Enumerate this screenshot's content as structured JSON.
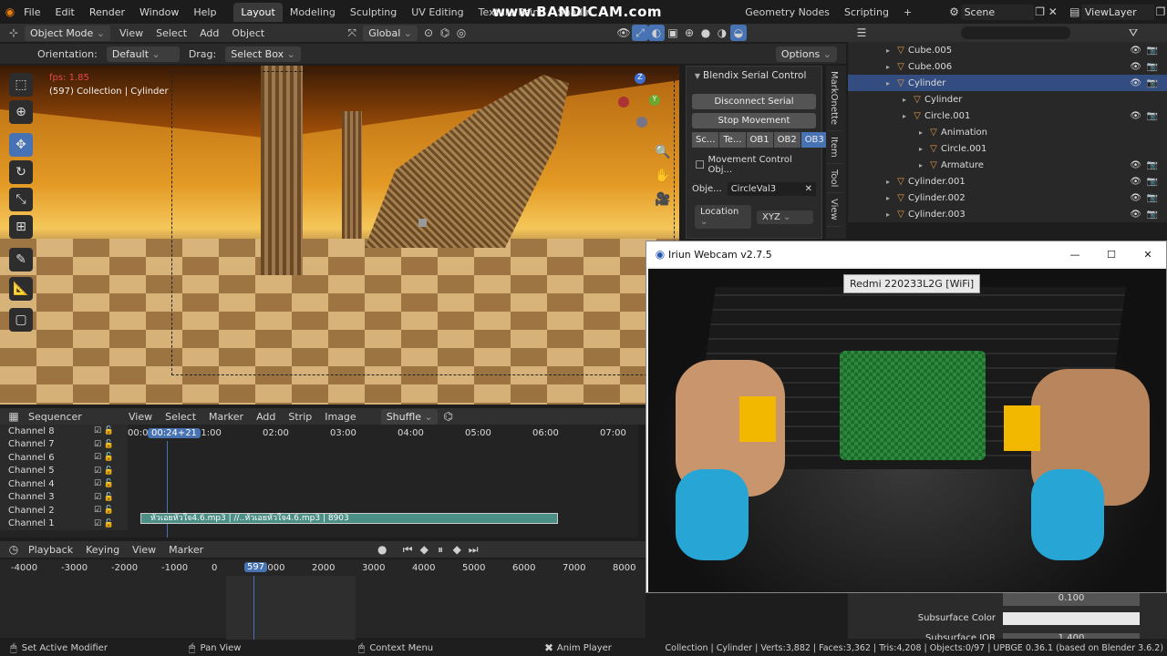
{
  "topbar": {
    "menus": [
      "File",
      "Edit",
      "Render",
      "Window",
      "Help"
    ],
    "workspaces": [
      "Layout",
      "Modeling",
      "Sculpting",
      "UV Editing",
      "Texture Paint",
      "Shadin"
    ],
    "workspaces2": [
      "Geometry Nodes",
      "Scripting"
    ],
    "add": "+",
    "watermark": "www.BANDICAM.com",
    "scene": "Scene",
    "viewlayer": "ViewLayer"
  },
  "vp_header": {
    "mode": "Object Mode",
    "menus": [
      "View",
      "Select",
      "Add",
      "Object"
    ],
    "transform": "Global"
  },
  "vp_tool": {
    "orientation_label": "Orientation:",
    "orientation": "Default",
    "drag_label": "Drag:",
    "drag": "Select Box",
    "options": "Options"
  },
  "vp_stats": {
    "fps": "fps: 1.85",
    "collection": "(597) Collection | Cylinder"
  },
  "gizmo": {
    "z": "Z",
    "y": "Y",
    "x": "X"
  },
  "npanel": {
    "title": "Blendix Serial Control",
    "btn1": "Disconnect Serial",
    "btn2": "Stop Movement",
    "tabs": [
      "Sc...",
      "Te...",
      "OB1",
      "OB2",
      "OB3"
    ],
    "section": "Movement Control Obj...",
    "obj_label": "Obje...",
    "obj_value": "CircleVal3",
    "loc": "Location",
    "xyz": "XYZ"
  },
  "sidetabs": [
    "MarkOnette",
    "Item",
    "Tool",
    "View"
  ],
  "outliner": {
    "rows": [
      {
        "name": "Cube.005",
        "indent": 1
      },
      {
        "name": "Cube.006",
        "indent": 1
      },
      {
        "name": "Cylinder",
        "indent": 1,
        "sel": true
      },
      {
        "name": "Cylinder",
        "indent": 2
      },
      {
        "name": "Circle.001",
        "indent": 2
      },
      {
        "name": "Animation",
        "indent": 3
      },
      {
        "name": "Circle.001",
        "indent": 3
      },
      {
        "name": "Armature",
        "indent": 3
      },
      {
        "name": "Cylinder.001",
        "indent": 1
      },
      {
        "name": "Cylinder.002",
        "indent": 1
      },
      {
        "name": "Cylinder.003",
        "indent": 1
      }
    ]
  },
  "seq": {
    "editor": "Sequencer",
    "menus": [
      "View",
      "Select",
      "Marker",
      "Add",
      "Strip",
      "Image"
    ],
    "shuffle": "Shuffle",
    "channels": [
      "Channel 8",
      "Channel 7",
      "Channel 6",
      "Channel 5",
      "Channel 4",
      "Channel 3",
      "Channel 2",
      "Channel 1"
    ],
    "current": "00:24+21",
    "times": [
      "00:0",
      "01:00",
      "02:00",
      "03:00",
      "04:00",
      "05:00",
      "06:00",
      "07:00"
    ],
    "strip": "หัวเอยหัวใจ4.6.mp3 | //..หัวเอยหัวใจ4.6.mp3 | 8903"
  },
  "timeline": {
    "menus": [
      "Playback",
      "Keying",
      "View",
      "Marker"
    ],
    "frame": "597",
    "ticks": [
      "-4000",
      "-3000",
      "-2000",
      "-1000",
      "0",
      "1000",
      "2000",
      "3000",
      "4000",
      "5000",
      "6000",
      "7000",
      "8000"
    ]
  },
  "iriun": {
    "title": "Iriun Webcam v2.7.5",
    "device": "Redmi 220233L2G [WiFi]",
    "min": "—",
    "max": "☐",
    "close": "✕"
  },
  "props": {
    "value": "0.100",
    "label": "Subsurface Color",
    "label2": "Subsurface IOR",
    "value2": "1.400"
  },
  "status": {
    "s1": "Set Active Modifier",
    "s2": "Pan View",
    "s3": "Context Menu",
    "s4": "Anim Player",
    "info": "Collection | Cylinder | Verts:3,882 | Faces:3,362 | Tris:4,208 | Objects:0/97 | UPBGE 0.36.1 (based on Blender 3.6.2)"
  }
}
